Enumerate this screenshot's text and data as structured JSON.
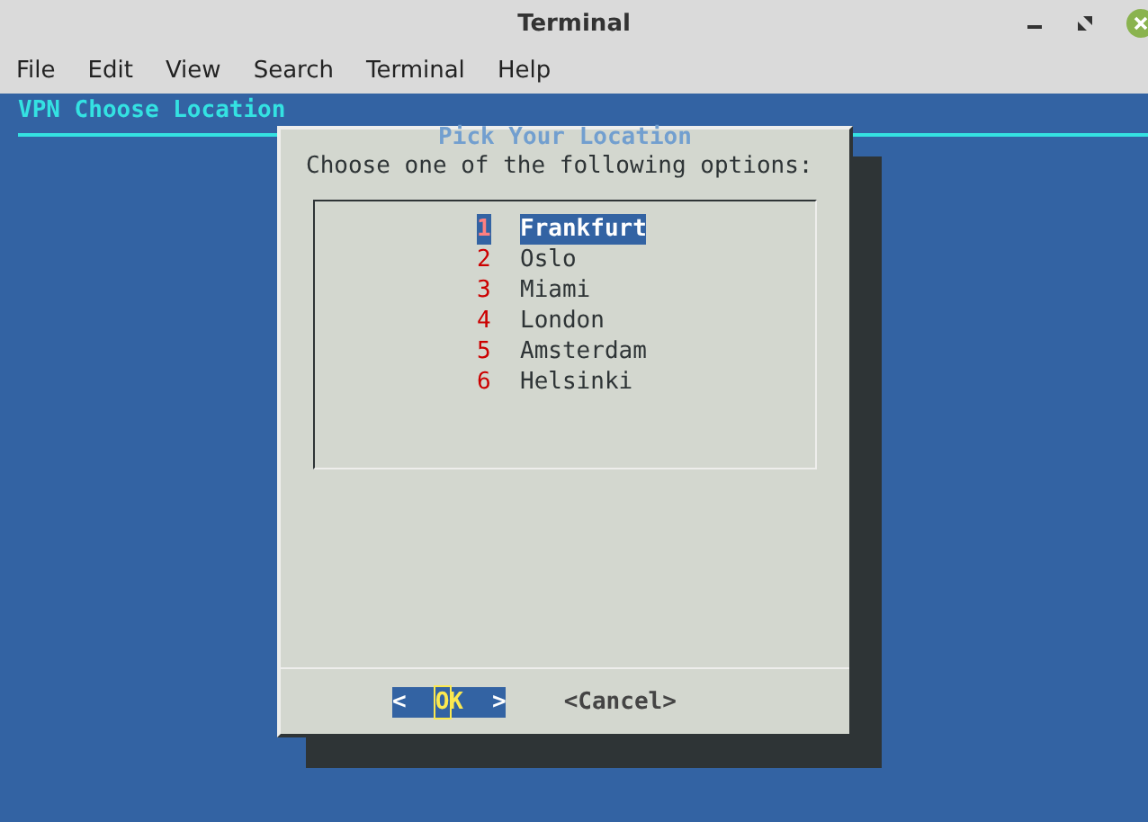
{
  "window": {
    "title": "Terminal"
  },
  "menu": [
    "File",
    "Edit",
    "View",
    "Search",
    "Terminal",
    "Help"
  ],
  "backtitle": "VPN Choose Location",
  "dialog": {
    "title": "Pick Your Location",
    "prompt": "Choose one of the following options:",
    "items": [
      {
        "tag": "1",
        "label": "Frankfurt",
        "selected": true
      },
      {
        "tag": "2",
        "label": "Oslo",
        "selected": false
      },
      {
        "tag": "3",
        "label": "Miami",
        "selected": false
      },
      {
        "tag": "4",
        "label": "London",
        "selected": false
      },
      {
        "tag": "5",
        "label": "Amsterdam",
        "selected": false
      },
      {
        "tag": "6",
        "label": "Helsinki",
        "selected": false
      }
    ],
    "buttons": [
      {
        "open": "<",
        "label": "OK",
        "close": ">",
        "selected": true
      },
      {
        "open": "<",
        "label": "Cancel",
        "close": ">",
        "selected": false
      }
    ]
  }
}
